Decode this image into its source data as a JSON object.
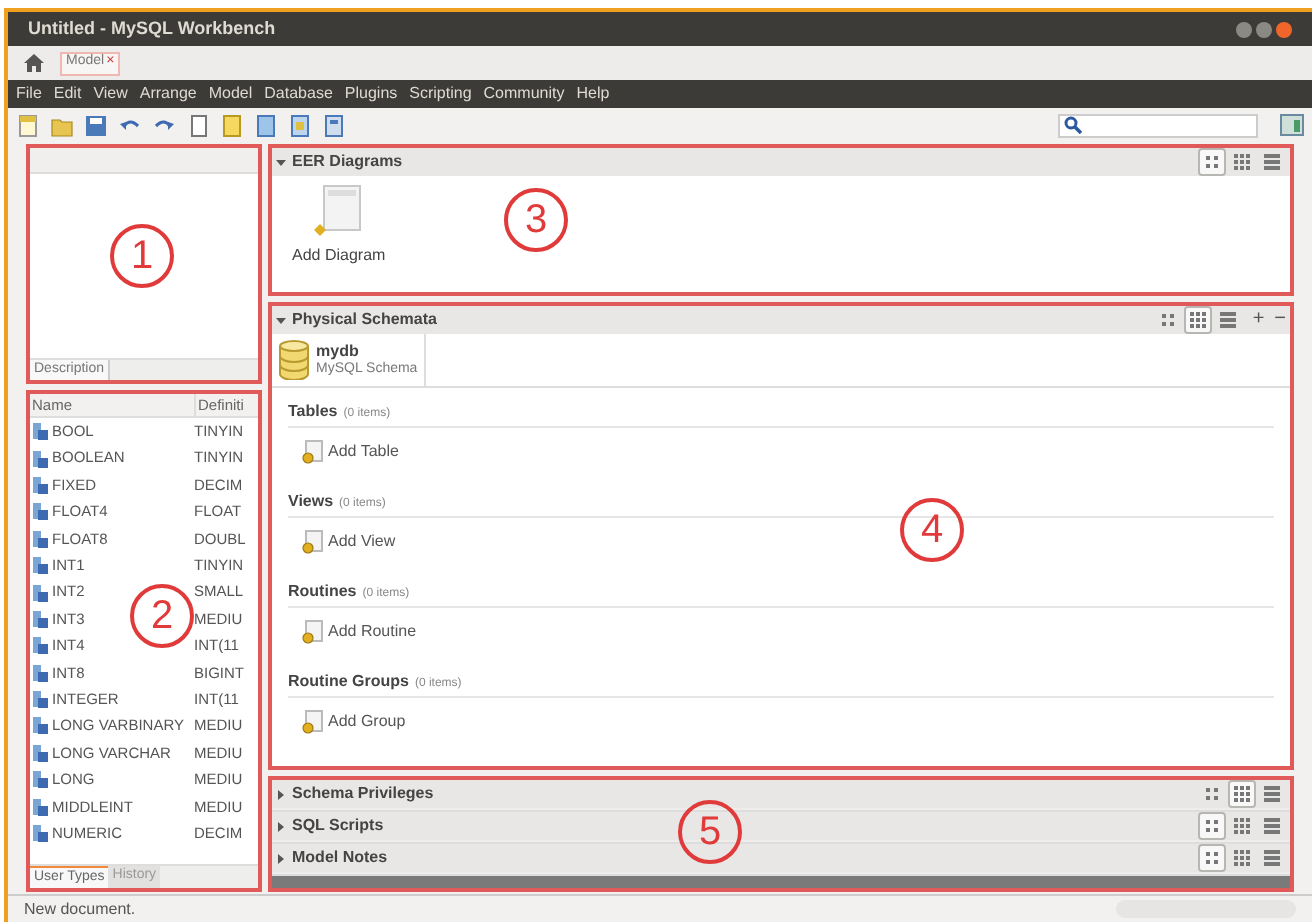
{
  "window": {
    "title": "Untitled - MySQL Workbench"
  },
  "tabs": [
    {
      "label": "Model",
      "close": "×",
      "selected": true
    }
  ],
  "menu": [
    "File",
    "Edit",
    "View",
    "Arrange",
    "Model",
    "Database",
    "Plugins",
    "Scripting",
    "Community",
    "Help"
  ],
  "object_panel": {
    "callout": "1",
    "tabs": [
      {
        "label": "Description",
        "selected": true
      }
    ]
  },
  "types_panel": {
    "callout": "2",
    "columns": [
      "Name",
      "Definiti"
    ],
    "rows": [
      {
        "name": "BOOL",
        "definition": "TINYIN"
      },
      {
        "name": "BOOLEAN",
        "definition": "TINYIN"
      },
      {
        "name": "FIXED",
        "definition": "DECIM"
      },
      {
        "name": "FLOAT4",
        "definition": "FLOAT"
      },
      {
        "name": "FLOAT8",
        "definition": "DOUBL"
      },
      {
        "name": "INT1",
        "definition": "TINYIN"
      },
      {
        "name": "INT2",
        "definition": "SMALL"
      },
      {
        "name": "INT3",
        "definition": "MEDIU"
      },
      {
        "name": "INT4",
        "definition": "INT(11"
      },
      {
        "name": "INT8",
        "definition": "BIGINT"
      },
      {
        "name": "INTEGER",
        "definition": "INT(11"
      },
      {
        "name": "LONG VARBINARY",
        "definition": "MEDIU"
      },
      {
        "name": "LONG VARCHAR",
        "definition": "MEDIU"
      },
      {
        "name": "LONG",
        "definition": "MEDIU"
      },
      {
        "name": "MIDDLEINT",
        "definition": "MEDIU"
      },
      {
        "name": "NUMERIC",
        "definition": "DECIM"
      }
    ],
    "tabs": [
      {
        "label": "User Types",
        "selected": true
      },
      {
        "label": "History",
        "selected": false
      }
    ]
  },
  "eer": {
    "title": "EER Diagrams",
    "callout": "3",
    "expanded": true,
    "view_modes": [
      {
        "selected": true
      },
      {
        "selected": false
      },
      {
        "selected": false
      }
    ],
    "items": [
      {
        "label": "Add Diagram"
      }
    ]
  },
  "schemata": {
    "title": "Physical Schemata",
    "callout": "4",
    "expanded": true,
    "actions": [
      "+",
      "−"
    ],
    "view_modes": [
      {
        "selected": false
      },
      {
        "selected": true
      },
      {
        "selected": false
      }
    ],
    "schema_tab": {
      "name": "mydb",
      "subtitle": "MySQL Schema",
      "selected": true
    },
    "groups": [
      {
        "title": "Tables",
        "count": "(0 items)",
        "add_label": "Add Table"
      },
      {
        "title": "Views",
        "count": "(0 items)",
        "add_label": "Add View"
      },
      {
        "title": "Routines",
        "count": "(0 items)",
        "add_label": "Add Routine"
      },
      {
        "title": "Routine Groups",
        "count": "(0 items)",
        "add_label": "Add Group"
      }
    ]
  },
  "collapsed_sections": {
    "callout": "5",
    "items": [
      {
        "title": "Schema Privileges",
        "expanded": false,
        "view_modes": [
          {
            "selected": false
          },
          {
            "selected": true
          },
          {
            "selected": false
          }
        ]
      },
      {
        "title": "SQL Scripts",
        "expanded": false,
        "view_modes": [
          {
            "selected": true
          },
          {
            "selected": false
          },
          {
            "selected": false
          }
        ]
      },
      {
        "title": "Model Notes",
        "expanded": false,
        "view_modes": [
          {
            "selected": true
          },
          {
            "selected": false
          },
          {
            "selected": false
          }
        ]
      }
    ]
  },
  "status_bar": "New document."
}
